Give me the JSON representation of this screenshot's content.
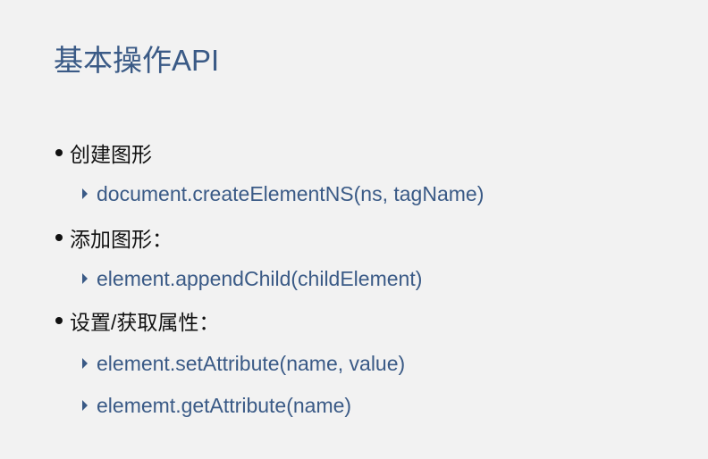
{
  "title": "基本操作API",
  "sections": [
    {
      "label": "创建图形",
      "items": [
        "document.createElementNS(ns, tagName)"
      ]
    },
    {
      "label": "添加图形：",
      "items": [
        "element.appendChild(childElement)"
      ]
    },
    {
      "label": "设置/获取属性：",
      "items": [
        "element.setAttribute(name, value)",
        "elememt.getAttribute(name)"
      ]
    }
  ],
  "colors": {
    "background": "#f2f2f2",
    "accent": "#3a5a86",
    "text": "#111111"
  },
  "icons": {
    "bullet": "bullet-dot-icon",
    "sub_bullet": "triangle-right-icon"
  }
}
